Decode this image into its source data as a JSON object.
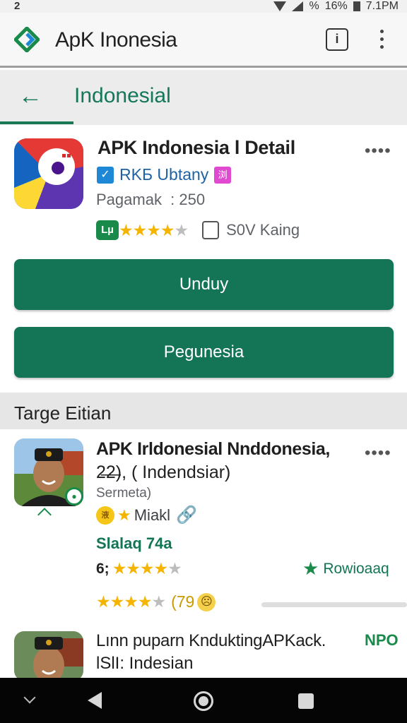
{
  "status_bar": {
    "left_glyph": "2",
    "battery_percent": "%",
    "battery_level": "16%",
    "time": "7.1PM"
  },
  "app_bar": {
    "title": "ApK Inonesia",
    "info_label": "i"
  },
  "sub_bar": {
    "title": "Indonesial"
  },
  "detail": {
    "title": "APK Indonesia l Detail",
    "developer": "RKБ Ubtany",
    "pink_badge": "浏",
    "meta": "Pagamak  : 250",
    "green_badge": "Lµ",
    "rating": 4,
    "size": "S0V Kaing"
  },
  "buttons": {
    "download": "Unduy",
    "secondary": "Pegunesia"
  },
  "section": {
    "title": "Targe Eitian"
  },
  "items": [
    {
      "title": "APK Irldonesial Nnddonesia,",
      "subtitle": "2̶2̶), ( Indendsiar)",
      "meta": "Sermeta)",
      "coin_label": "液",
      "tag": "Miakl",
      "green_text": "Slalaq 74a",
      "rating_num": "6;",
      "rating": 4,
      "review_label": "Rowioaaq",
      "rating_num_2": "(79",
      "rating_2": 4,
      "face": "☹"
    },
    {
      "title": "Lınn puparn KnduktingAPKack.",
      "badge": "NPO",
      "subtitle": "lSlI: Indesian"
    }
  ],
  "colors": {
    "primary": "#137555",
    "accent_green": "#1a8a4a",
    "star": "#f5b400"
  },
  "icons": {
    "back": "arrow-back-icon",
    "info": "info-icon",
    "more": "more-vert-icon"
  }
}
